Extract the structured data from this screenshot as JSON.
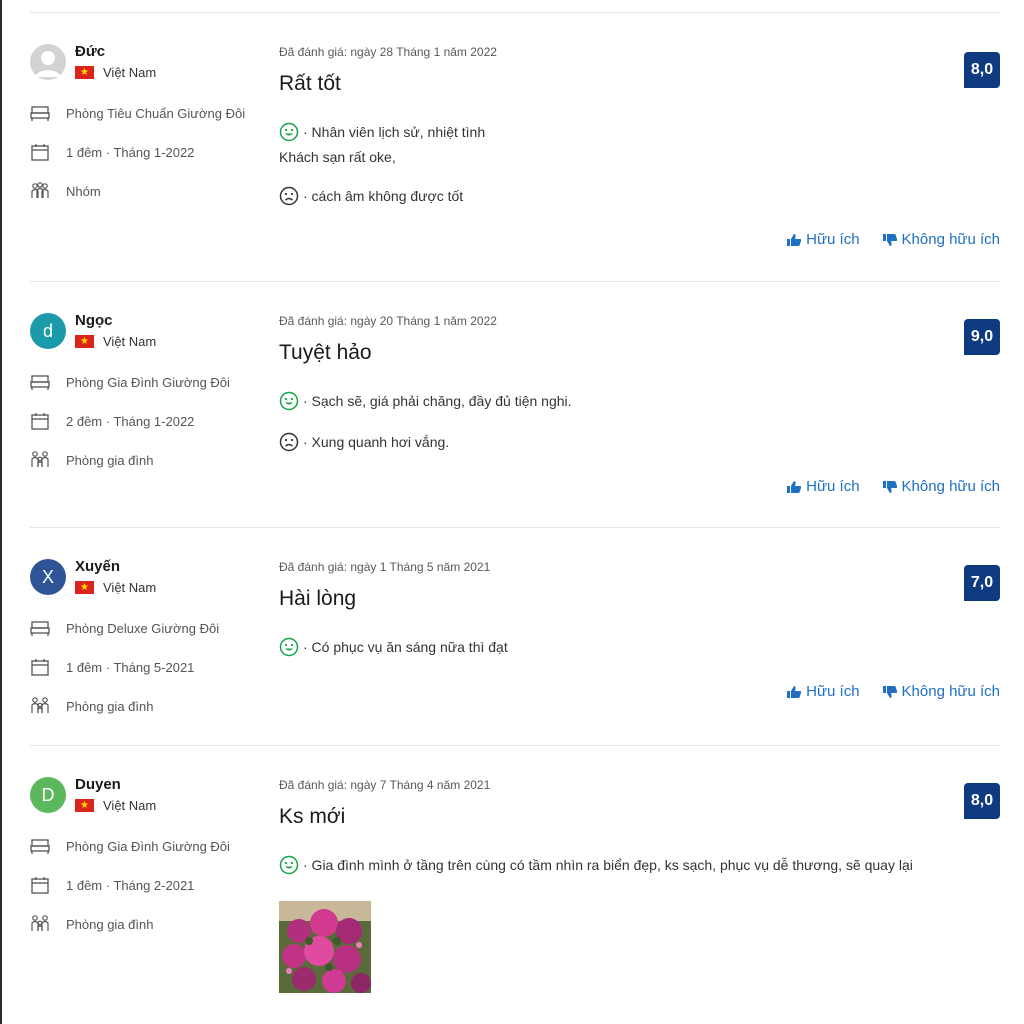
{
  "colors": {
    "score_bg": "#0e3a80",
    "link": "#1f6fc4",
    "positive": "#16a34a",
    "negative": "#333333"
  },
  "actions": {
    "helpful": "Hữu ích",
    "not_helpful": "Không hữu ích"
  },
  "reviews": [
    {
      "name": "Đức",
      "avatar": {
        "type": "placeholder",
        "letter": "",
        "color": "#bdbdbd"
      },
      "country": "Việt Nam",
      "room": "Phòng Tiêu Chuẩn Giường Đôi",
      "stay": "1 đêm · Tháng 1-2022",
      "traveler": "Nhóm",
      "date": "Đã đánh giá: ngày 28 Tháng 1 năm 2022",
      "title": "Rất tốt",
      "score": "8,0",
      "positive": "· Nhân viên lịch sử, nhiệt tình",
      "positive_extra": "Khách sạn rất oke,",
      "negative": "· cách âm không được tốt"
    },
    {
      "name": "Ngọc",
      "avatar": {
        "type": "letter",
        "letter": "d",
        "color": "#1b9aaa"
      },
      "country": "Việt Nam",
      "room": "Phòng Gia Đình Giường Đôi",
      "stay": "2 đêm · Tháng 1-2022",
      "traveler": "Phòng gia đình",
      "date": "Đã đánh giá: ngày 20 Tháng 1 năm 2022",
      "title": "Tuyệt hảo",
      "score": "9,0",
      "positive": "· Sạch sẽ, giá phải chăng, đầy đủ tiện nghi.",
      "negative": "· Xung quanh hơi vắng."
    },
    {
      "name": "Xuyến",
      "avatar": {
        "type": "letter",
        "letter": "X",
        "color": "#2f5597"
      },
      "country": "Việt Nam",
      "room": "Phòng Deluxe Giường Đôi",
      "stay": "1 đêm · Tháng 5-2021",
      "traveler": "Phòng gia đình",
      "date": "Đã đánh giá: ngày 1 Tháng 5 năm 2021",
      "title": "Hài lòng",
      "score": "7,0",
      "positive": "· Có phục vụ ăn sáng nữa thì đạt"
    },
    {
      "name": "Duyen",
      "avatar": {
        "type": "letter",
        "letter": "D",
        "color": "#5cb85c"
      },
      "country": "Việt Nam",
      "room": "Phòng Gia Đình Giường Đôi",
      "stay": "1 đêm · Tháng 2-2021",
      "traveler": "Phòng gia đình",
      "date": "Đã đánh giá: ngày 7 Tháng 4 năm 2021",
      "title": "Ks mới",
      "score": "8,0",
      "positive": "· Gia đình mình ở tầng trên cùng có tầm nhìn ra biển đẹp, ks sạch, phục vụ dễ thương, sẽ quay lại",
      "photo": "flower-photo"
    }
  ]
}
